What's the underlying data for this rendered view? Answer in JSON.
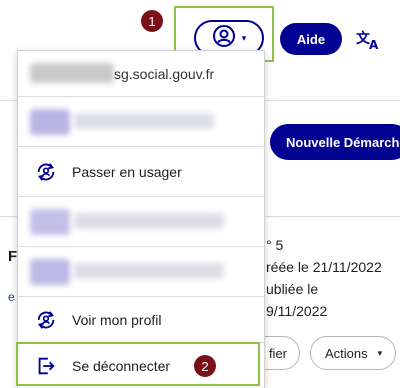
{
  "header": {
    "aide_label": "Aide",
    "account_dropdown_glyph": "▾",
    "translate_icon": "translate-icon",
    "account_icon": "user-circle-icon"
  },
  "annotations": {
    "step1": "1",
    "step2": "2",
    "highlight_color": "#8bc34a",
    "badge_color": "#7a1018"
  },
  "menu": {
    "email_suffix": "sg.social.gouv.fr",
    "switch_user_label": "Passer en usager",
    "profile_label": "Voir mon profil",
    "logout_label": "Se déconnecter"
  },
  "background": {
    "new_procedure_label": "Nouvelle Démarche",
    "number_text": "° 5",
    "created_text": "réée le 21/11/2022",
    "published_text": "ubliée le",
    "published_date": "9/11/2022",
    "fragment_f": "F",
    "fragment_e": "e",
    "modify_fragment": "fier",
    "actions_label": "Actions",
    "actions_caret": "▾"
  },
  "colors": {
    "primary": "#000091",
    "text": "#1e1e1e"
  }
}
